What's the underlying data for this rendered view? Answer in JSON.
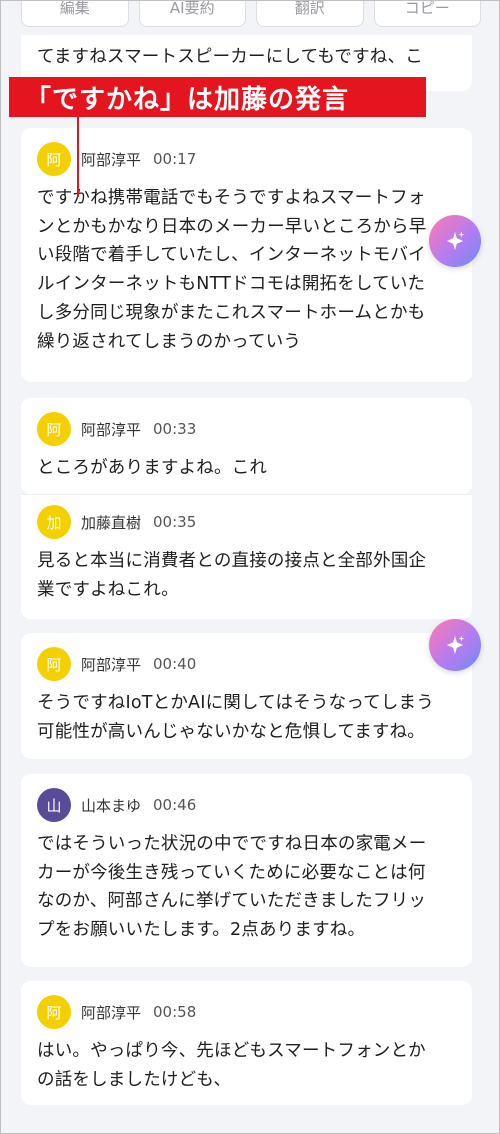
{
  "top_actions": [
    "編集",
    "AI要約",
    "翻訳",
    "コピー"
  ],
  "banner": "「ですかね」は加藤の発言",
  "colors": {
    "banner": "#e5151f",
    "avatar_abe": "#f5d000",
    "avatar_kato": "#f5d000",
    "avatar_yamamoto": "#5a4a9a"
  },
  "first_card": {
    "text": "てますねスマートスピーカーにしてもですね、こ"
  },
  "entries": [
    {
      "avatar": "阿",
      "speaker": "阿部淳平",
      "time": "00:17",
      "text": "ですかね携帯電話でもそうですよねスマートフォ\nンとかもかなり日本のメーカー早いところから早\nい段階で着手していたし、インターネットモバイ\nルインターネットもNTTドコモは開拓をしていた\nし多分同じ現象がまたこれスマートホームとかも\n繰り返されてしまうのかっていう"
    },
    {
      "avatar": "阿",
      "speaker": "阿部淳平",
      "time": "00:33",
      "text": "ところがありますよね。これ"
    },
    {
      "avatar": "加",
      "speaker": "加藤直樹",
      "time": "00:35",
      "text": "見ると本当に消費者との直接の接点と全部外国企\n業ですよねこれ。"
    },
    {
      "avatar": "阿",
      "speaker": "阿部淳平",
      "time": "00:40",
      "text": "そうですねIoTとかAIに関してはそうなってしまう\n可能性が高いんじゃないかなと危惧してますね。"
    },
    {
      "avatar": "山",
      "speaker": "山本まゆ",
      "time": "00:46",
      "text": "ではそういった状況の中でですね日本の家電メー\nカーが今後生き残っていくために必要なことは何\nなのか、阿部さんに挙げていただきましたフリッ\nプをお願いいたします。2点ありますね。"
    },
    {
      "avatar": "阿",
      "speaker": "阿部淳平",
      "time": "00:58",
      "text": "はい。やっぱり今、先ほどもスマートフォンとか\nの話をしましたけども、"
    }
  ],
  "icons": {
    "ai_button": "sparkle-icon"
  }
}
